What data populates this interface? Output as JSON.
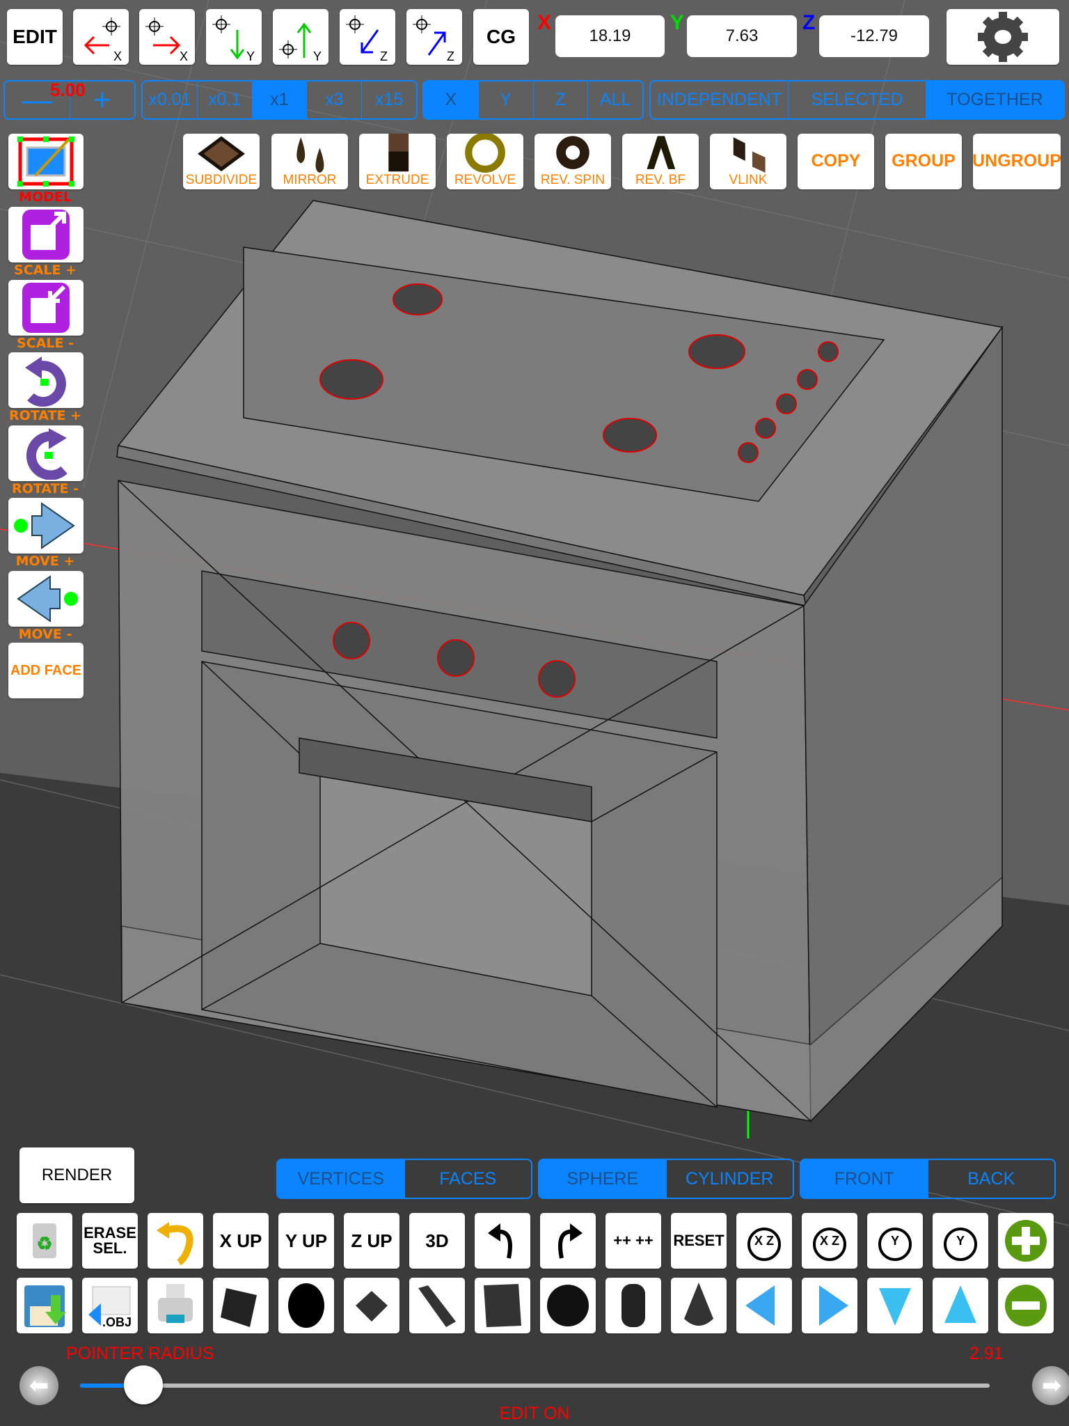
{
  "toolbar": {
    "edit": "EDIT",
    "cg": "CG",
    "axis_buttons": [
      {
        "icon": "move-x-negative-icon",
        "axis": "X"
      },
      {
        "icon": "move-x-positive-icon",
        "axis": "X"
      },
      {
        "icon": "move-y-negative-icon",
        "axis": "Y"
      },
      {
        "icon": "move-y-positive-icon",
        "axis": "Y"
      },
      {
        "icon": "move-z-negative-icon",
        "axis": "Z"
      },
      {
        "icon": "move-z-positive-icon",
        "axis": "Z"
      }
    ],
    "coords": {
      "x_label": "X",
      "x": "18.19",
      "y_label": "Y",
      "y": "7.63",
      "z_label": "Z",
      "z": "-12.79"
    },
    "settings_icon": "gear-icon"
  },
  "step": {
    "minus": "—",
    "value": "5.00",
    "plus": "+"
  },
  "multipliers": {
    "items": [
      "x0.01",
      "x0.1",
      "x1",
      "x3",
      "x15"
    ],
    "selected": "x1"
  },
  "axes": {
    "items": [
      "X",
      "Y",
      "Z",
      "ALL"
    ],
    "selected": "X"
  },
  "mode": {
    "items": [
      "INDEPENDENT",
      "SELECTED",
      "TOGETHER"
    ],
    "selected": "TOGETHER"
  },
  "tools": [
    {
      "label": "SUBDIVIDE",
      "icon": "subdivide-icon"
    },
    {
      "label": "MIRROR",
      "icon": "mirror-icon"
    },
    {
      "label": "EXTRUDE",
      "icon": "extrude-icon"
    },
    {
      "label": "REVOLVE",
      "icon": "revolve-icon"
    },
    {
      "label": "REV. SPIN",
      "icon": "rev-spin-icon"
    },
    {
      "label": "REV. BF",
      "icon": "rev-bf-icon"
    },
    {
      "label": "VLINK",
      "icon": "vlink-icon"
    },
    {
      "label": "COPY"
    },
    {
      "label": "GROUP"
    },
    {
      "label": "UNGROUP"
    }
  ],
  "left_tools": [
    {
      "label": "MODEL",
      "icon": "model-edit-icon"
    },
    {
      "label": "SCALE +",
      "icon": "scale-up-icon"
    },
    {
      "label": "SCALE -",
      "icon": "scale-down-icon"
    },
    {
      "label": "ROTATE +",
      "icon": "rotate-cw-icon"
    },
    {
      "label": "ROTATE -",
      "icon": "rotate-ccw-icon"
    },
    {
      "label": "MOVE +",
      "icon": "move-forward-icon"
    },
    {
      "label": "MOVE -",
      "icon": "move-back-icon"
    },
    {
      "label": "ADD FACE"
    }
  ],
  "bottom": {
    "render": "RENDER",
    "selection": {
      "items": [
        "VERTICES",
        "FACES"
      ],
      "selected": "VERTICES"
    },
    "shape": {
      "items": [
        "SPHERE",
        "CYLINDER"
      ],
      "selected": "SPHERE"
    },
    "side": {
      "items": [
        "FRONT",
        "BACK"
      ],
      "selected": "FRONT"
    },
    "row1": [
      {
        "icon": "recycle-bin-icon"
      },
      {
        "label": "ERASE SEL."
      },
      {
        "icon": "undo-curve-icon"
      },
      {
        "label": "X UP"
      },
      {
        "label": "Y UP"
      },
      {
        "label": "Z UP"
      },
      {
        "label": "3D"
      },
      {
        "icon": "undo-icon"
      },
      {
        "icon": "redo-icon"
      },
      {
        "label": "++ ++"
      },
      {
        "label": "RESET"
      },
      {
        "icon": "rotate-xz-left-icon",
        "label": "X Z"
      },
      {
        "icon": "rotate-xz-right-icon",
        "label": "X Z"
      },
      {
        "icon": "rotate-y-left-icon",
        "label": "Y"
      },
      {
        "icon": "rotate-y-right-icon",
        "label": "Y"
      },
      {
        "icon": "zoom-in-plus-icon"
      }
    ],
    "row2": [
      {
        "icon": "save-icon"
      },
      {
        "icon": "export-obj-icon",
        "label": ".OBJ"
      },
      {
        "icon": "print-icon"
      },
      {
        "icon": "plane-primitive-icon"
      },
      {
        "icon": "disc-primitive-icon"
      },
      {
        "icon": "square-primitive-icon"
      },
      {
        "icon": "ramp-primitive-icon"
      },
      {
        "icon": "cube-primitive-icon"
      },
      {
        "icon": "sphere-primitive-icon"
      },
      {
        "icon": "cylinder-primitive-icon"
      },
      {
        "icon": "cone-primitive-icon"
      },
      {
        "icon": "arrow-left-icon"
      },
      {
        "icon": "arrow-right-icon"
      },
      {
        "icon": "arrow-down-icon"
      },
      {
        "icon": "arrow-up-icon"
      },
      {
        "icon": "zoom-out-minus-icon"
      }
    ],
    "pointer_label": "POINTER RADIUS",
    "pointer_value": "2.91",
    "pointer_fraction": 0.07,
    "status": "EDIT ON"
  },
  "colors": {
    "accent": "#0a84ff",
    "orange": "#ff8000",
    "red": "#ff0000",
    "x_axis": "#ff0000",
    "y_axis": "#00dd00",
    "z_axis": "#0000ff"
  }
}
